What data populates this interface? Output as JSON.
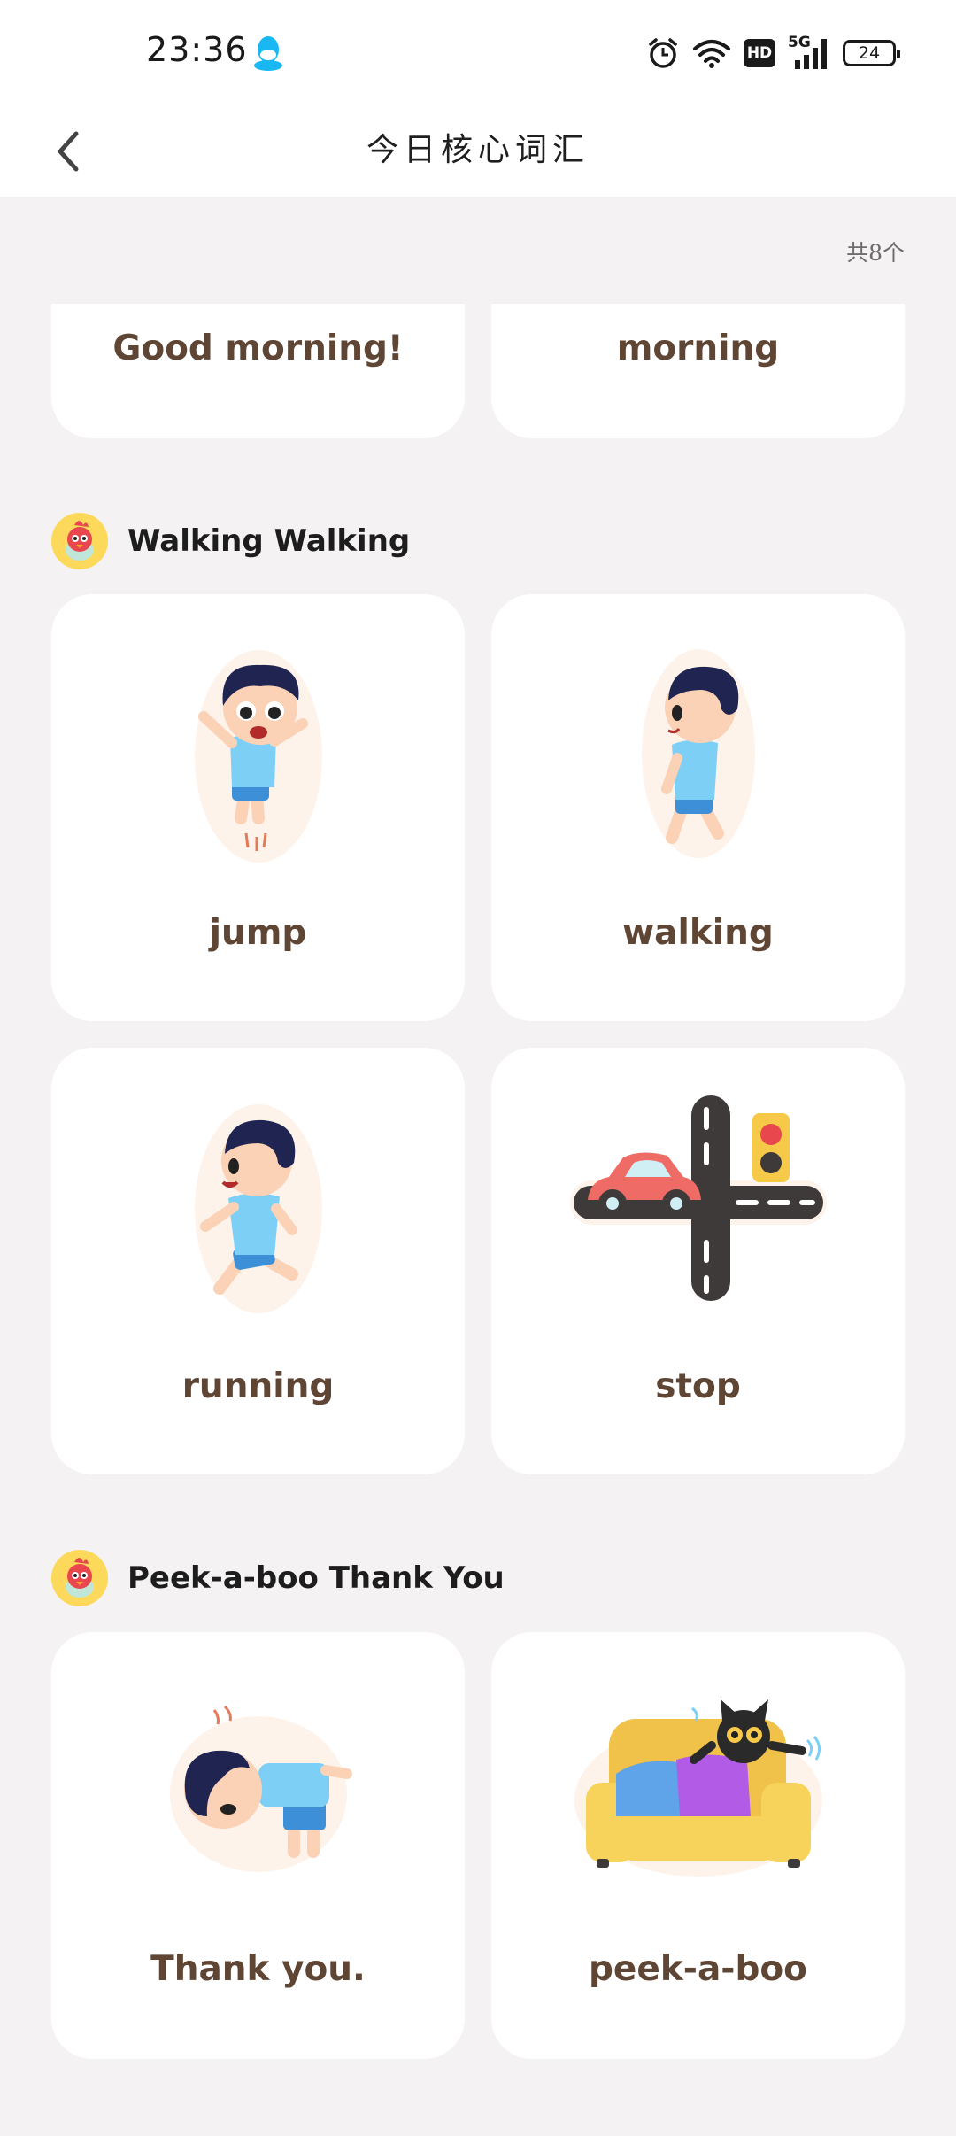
{
  "status_bar": {
    "time": "23:36",
    "battery": "24",
    "network": "5G",
    "hd": "HD",
    "icons": [
      "qq-icon",
      "alarm-icon",
      "wifi-icon",
      "hd-icon",
      "signal-5g-icon",
      "battery-icon"
    ]
  },
  "nav": {
    "title": "今日核心词汇",
    "back_icon": "chevron-left-icon"
  },
  "count_text": "共8个",
  "groups": [
    {
      "title": "",
      "cards": [
        {
          "word": "Good morning!"
        },
        {
          "word": "morning"
        }
      ]
    },
    {
      "title": "Walking Walking",
      "cards": [
        {
          "word": "jump",
          "icon": "boy-jumping-illustration"
        },
        {
          "word": "walking",
          "icon": "boy-walking-illustration"
        },
        {
          "word": "running",
          "icon": "boy-running-illustration"
        },
        {
          "word": "stop",
          "icon": "car-traffic-light-illustration"
        }
      ]
    },
    {
      "title": "Peek-a-boo Thank You",
      "cards": [
        {
          "word": "Thank you.",
          "icon": "boy-bowing-illustration"
        },
        {
          "word": "peek-a-boo",
          "icon": "cat-sofa-illustration"
        }
      ]
    }
  ],
  "colors": {
    "background": "#f4f2f3",
    "card": "#ffffff",
    "word_text": "#5f4534",
    "avatar_bg": "#fcd95a"
  }
}
